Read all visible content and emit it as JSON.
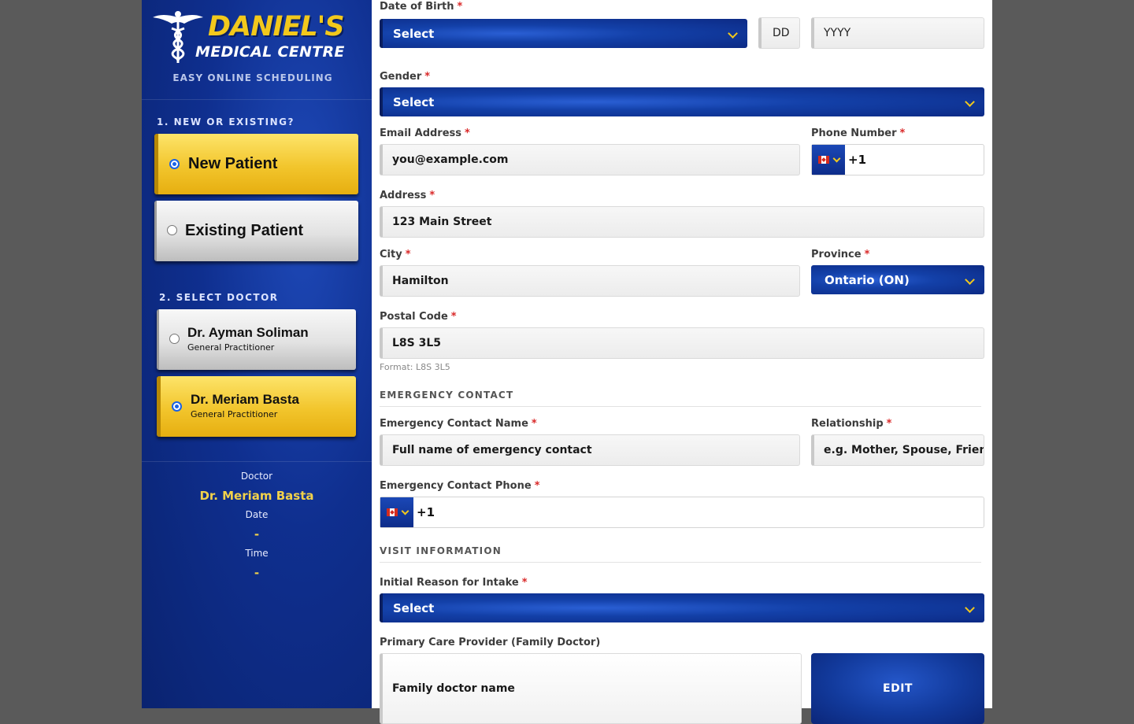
{
  "brand": {
    "name_line1": "DANIEL'S",
    "name_line2": "MEDICAL CENTRE",
    "tagline": "EASY ONLINE SCHEDULING"
  },
  "sidebar": {
    "step1_title": "1. NEW OR EXISTING?",
    "patient_options": [
      {
        "label": "New Patient",
        "selected": true
      },
      {
        "label": "Existing Patient",
        "selected": false
      }
    ],
    "step2_title": "2. SELECT DOCTOR",
    "doctors": [
      {
        "name": "Dr. Ayman Soliman",
        "role": "General Practitioner",
        "selected": false
      },
      {
        "name": "Dr. Meriam Basta",
        "role": "General Practitioner",
        "selected": true
      }
    ],
    "summary": {
      "doctor_label": "Doctor",
      "doctor_value": "Dr. Meriam Basta",
      "date_label": "Date",
      "date_value": "-",
      "time_label": "Time",
      "time_value": "-"
    }
  },
  "form": {
    "required_mark": "*",
    "dob": {
      "label": "Date of Birth",
      "month_value": "Select",
      "day_placeholder": "DD",
      "year_placeholder": "YYYY"
    },
    "gender": {
      "label": "Gender",
      "value": "Select"
    },
    "email": {
      "label": "Email Address",
      "placeholder": "you@example.com"
    },
    "phone": {
      "label": "Phone Number",
      "prefix": "+1"
    },
    "address": {
      "label": "Address",
      "placeholder": "123 Main Street"
    },
    "city": {
      "label": "City",
      "placeholder": "Hamilton"
    },
    "province": {
      "label": "Province",
      "value": "Ontario (ON)"
    },
    "postal": {
      "label": "Postal Code",
      "placeholder": "L8S 3L5",
      "hint": "Format: L8S 3L5"
    },
    "emergency_section": "EMERGENCY CONTACT",
    "emergency_name": {
      "label": "Emergency Contact Name",
      "placeholder": "Full name of emergency contact"
    },
    "relationship": {
      "label": "Relationship",
      "placeholder": "e.g. Mother, Spouse, Friend"
    },
    "emergency_phone": {
      "label": "Emergency Contact Phone",
      "prefix": "+1"
    },
    "visit_section": "VISIT INFORMATION",
    "reason": {
      "label": "Initial Reason for Intake",
      "value": "Select"
    },
    "pcp": {
      "label": "Primary Care Provider (Family Doctor)",
      "placeholder": "Family doctor name",
      "button": "EDIT"
    }
  },
  "colors": {
    "brand_blue": "#0f2f8f",
    "brand_gold": "#f2c81c",
    "selected_option": "#f2c52c",
    "required": "#d92828"
  }
}
